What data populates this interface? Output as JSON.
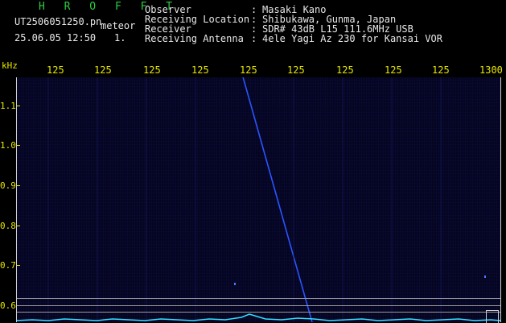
{
  "header": {
    "title": "H R O F F T",
    "filename": "UT2506051250.pn",
    "mode": "meteor",
    "datetime": "25.06.05 12:50",
    "index": "1.",
    "fields": [
      {
        "label": "Observer",
        "sep": ":",
        "value": "Masaki Kano"
      },
      {
        "label": "Receiving Location",
        "sep": ":",
        "value": "Shibukawa, Gunma, Japan"
      },
      {
        "label": "Receiver",
        "sep": ":",
        "value": "SDR# 43dB L15 111.6MHz USB"
      },
      {
        "label": "Receiving Antenna",
        "sep": ":",
        "value": "4ele Yagi Az 230 for Kansai VOR"
      }
    ]
  },
  "axes": {
    "y_unit": "kHz",
    "x_ticks": [
      "125",
      "125",
      "125",
      "125",
      "125",
      "125",
      "125",
      "125",
      "125",
      "1300"
    ],
    "y_ticks": [
      "1.1",
      "1.0",
      "0.9",
      "0.8",
      "0.7",
      "0.6"
    ]
  },
  "colors": {
    "title": "#2ecc40",
    "labels": "#e6e600",
    "trace": "#2a55ff",
    "background": "#050520"
  }
}
